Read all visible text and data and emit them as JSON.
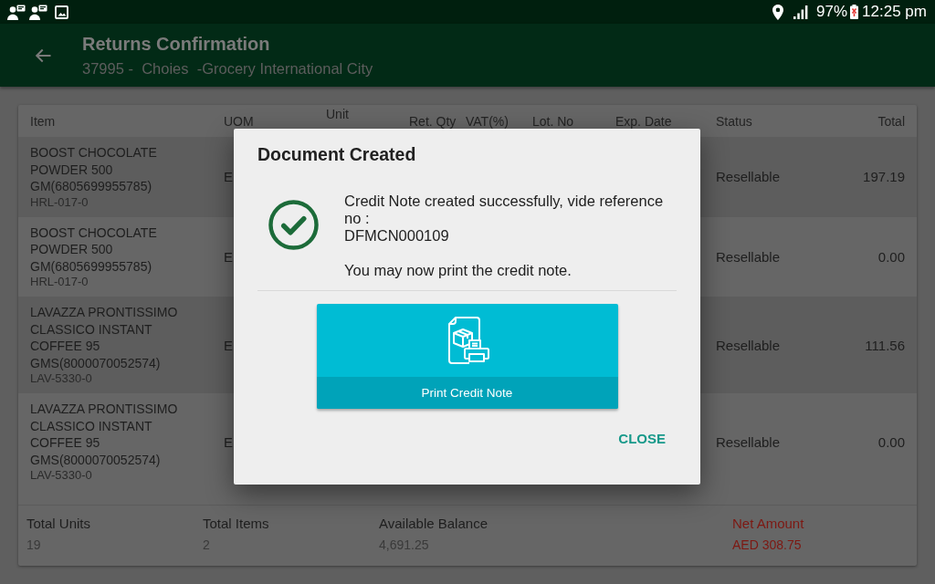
{
  "status_bar": {
    "battery": "97%",
    "time": "12:25 pm"
  },
  "app_bar": {
    "title": "Returns Confirmation",
    "subtitle": "37995 -  Choies  -Grocery International City"
  },
  "table": {
    "columns": [
      "Item",
      "UOM",
      "Unit",
      "Ret. Qty",
      "VAT(%)",
      "Lot. No",
      "Exp. Date",
      "Status",
      "Total"
    ],
    "rows": [
      {
        "item": "BOOST CHOCOLATE POWDER 500 GM(6805699955785)",
        "code": "HRL-017-0",
        "uom": "E",
        "status": "Resellable",
        "total": "197.19"
      },
      {
        "item": "BOOST CHOCOLATE POWDER 500 GM(6805699955785)",
        "code": "HRL-017-0",
        "uom": "E",
        "status": "Resellable",
        "total": "0.00"
      },
      {
        "item": "LAVAZZA PRONTISSIMO CLASSICO INSTANT COFFEE 95 GMS(8000070052574)",
        "code": "LAV-5330-0",
        "uom": "E",
        "status": "Resellable",
        "total": "111.56"
      },
      {
        "item": "LAVAZZA PRONTISSIMO CLASSICO INSTANT COFFEE 95 GMS(8000070052574)",
        "code": "LAV-5330-0",
        "uom": "E",
        "status": "Resellable",
        "total": "0.00"
      }
    ]
  },
  "summary": [
    {
      "label": "Total Units",
      "value": "19",
      "kind": "normal"
    },
    {
      "label": "Total Items",
      "value": "2",
      "kind": "normal"
    },
    {
      "label": "Available Balance",
      "value": "4,691.25",
      "kind": "normal"
    },
    {
      "label": "Net Amount",
      "value": "AED 308.75",
      "kind": "alert"
    }
  ],
  "dialog": {
    "title": "Document Created",
    "message": "Credit Note created successfully, vide reference no :",
    "reference": "DFMCN000109",
    "note": "You may now print the credit note.",
    "print_button": "Print Credit Note",
    "close_button": "CLOSE"
  }
}
